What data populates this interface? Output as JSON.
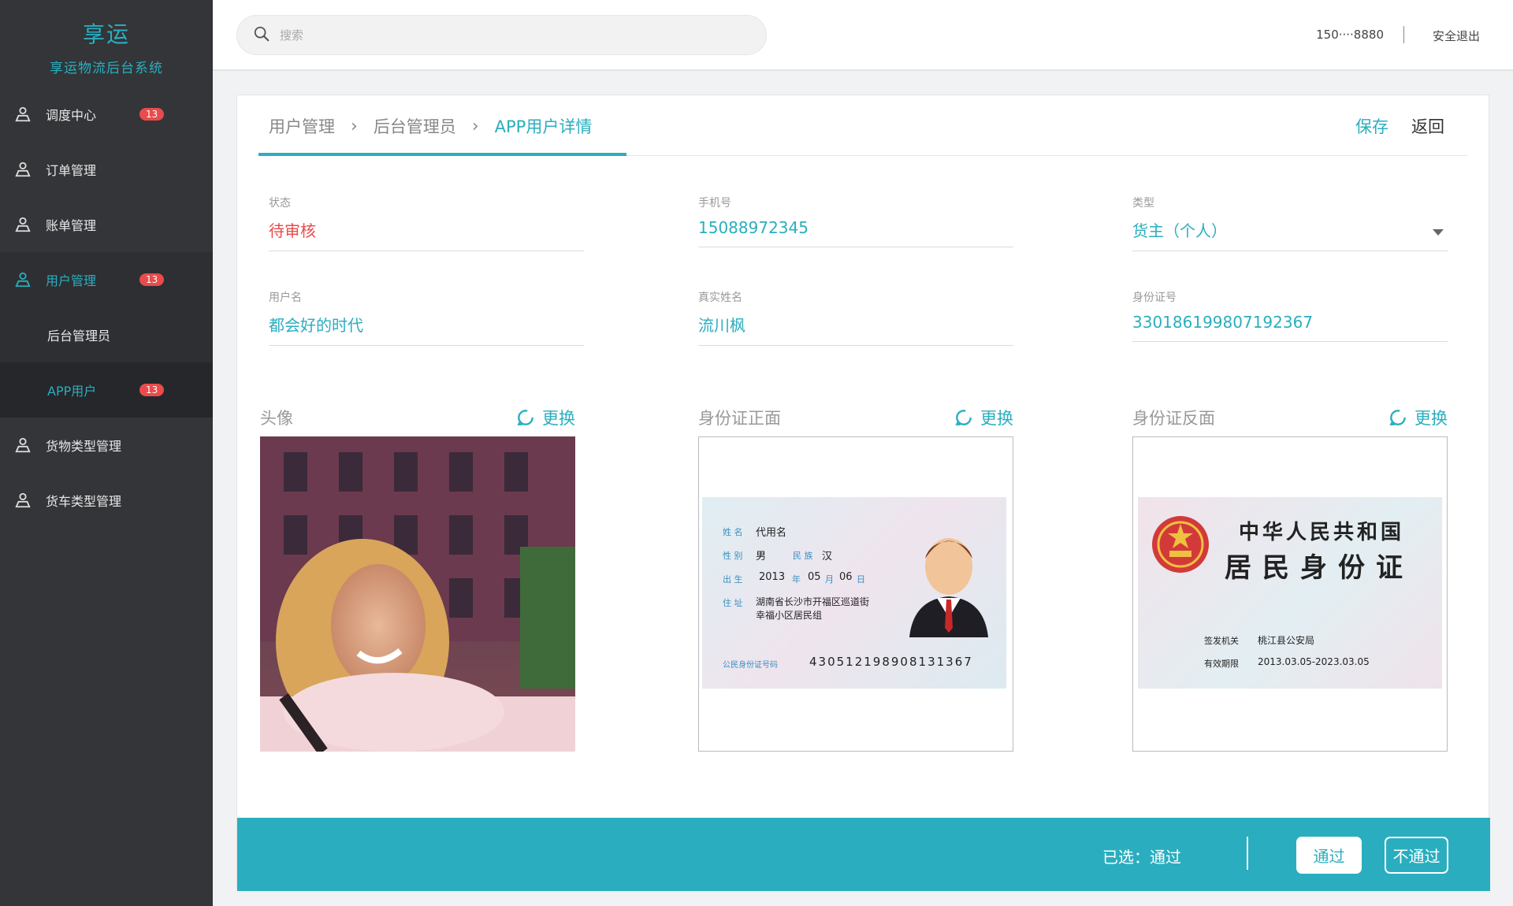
{
  "brand": {
    "title": "享运",
    "subtitle": "享运物流后台系统"
  },
  "sidebar": {
    "items": [
      {
        "label": "调度中心",
        "badge": "13"
      },
      {
        "label": "订单管理"
      },
      {
        "label": "账单管理"
      },
      {
        "label": "用户管理",
        "badge": "13"
      },
      {
        "label": "后台管理员"
      },
      {
        "label": "APP用户",
        "badge": "13"
      },
      {
        "label": "货物类型管理"
      },
      {
        "label": "货车类型管理"
      }
    ]
  },
  "header": {
    "search_placeholder": "搜索",
    "phone": "150····8880",
    "logout": "安全退出"
  },
  "breadcrumb": [
    "用户管理",
    "后台管理员",
    "APP用户详情"
  ],
  "actions": {
    "save": "保存",
    "back": "返回"
  },
  "fields": {
    "status": {
      "label": "状态",
      "value": "待审核"
    },
    "phone": {
      "label": "手机号",
      "value": "15088972345"
    },
    "type": {
      "label": "类型",
      "value": "货主（个人）"
    },
    "username": {
      "label": "用户名",
      "value": "都会好的时代"
    },
    "realname": {
      "label": "真实姓名",
      "value": "流川枫"
    },
    "idnumber": {
      "label": "身份证号",
      "value": "330186199807192367"
    }
  },
  "images": {
    "change_label": "更换",
    "avatar": {
      "title": "头像"
    },
    "id_front": {
      "title": "身份证正面",
      "name_label": "姓 名",
      "name": "代用名",
      "sex_label": "性 别",
      "sex": "男",
      "nation_label": "民 族",
      "nation": "汉",
      "birth_label": "出 生",
      "year": "2013",
      "year_unit": "年",
      "month": "05",
      "month_unit": "月",
      "day": "06",
      "day_unit": "日",
      "addr_label": "住 址",
      "addr1": "湖南省长沙市开福区巡道街",
      "addr2": "幸福小区居民组",
      "idno_label": "公民身份证号码",
      "idno": "430512198908131367"
    },
    "id_back": {
      "title": "身份证反面",
      "country": "中华人民共和国",
      "card_name": "居民身份证",
      "authority_label": "签发机关",
      "authority": "桃江县公安局",
      "validity_label": "有效期限",
      "validity": "2013.03.05-2023.03.05"
    }
  },
  "footer": {
    "selected": "已选：通过",
    "pass": "通过",
    "fail": "不通过"
  },
  "colors": {
    "accent": "#2aaebf",
    "danger": "#e94b4b",
    "sidebar": "#333538"
  }
}
